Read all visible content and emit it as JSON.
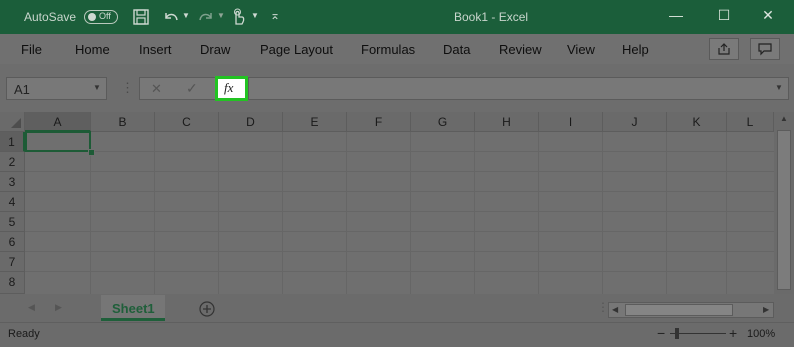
{
  "titlebar": {
    "autosave_label": "AutoSave",
    "autosave_state": "Off",
    "title": "Book1  -  Excel",
    "minimize_glyph": "—",
    "maximize_glyph": "☐",
    "close_glyph": "✕"
  },
  "menu": {
    "items": [
      "File",
      "Home",
      "Insert",
      "Draw",
      "Page Layout",
      "Formulas",
      "Data",
      "Review",
      "View",
      "Help"
    ]
  },
  "formula_bar": {
    "name_box_value": "A1",
    "fx_label": "fx",
    "formula_value": ""
  },
  "grid": {
    "columns": [
      "A",
      "B",
      "C",
      "D",
      "E",
      "F",
      "G",
      "H",
      "I",
      "J",
      "K",
      "L"
    ],
    "rows": [
      "1",
      "2",
      "3",
      "4",
      "5",
      "6",
      "7",
      "8"
    ],
    "selected_cell": "A1"
  },
  "sheets": {
    "tabs": [
      "Sheet1"
    ],
    "active": "Sheet1"
  },
  "status": {
    "text": "Ready",
    "zoom": "100%"
  },
  "colors": {
    "title_bg": "#1b5e3a",
    "highlight": "#22c322",
    "active_tab_text": "#1f5f3a"
  }
}
